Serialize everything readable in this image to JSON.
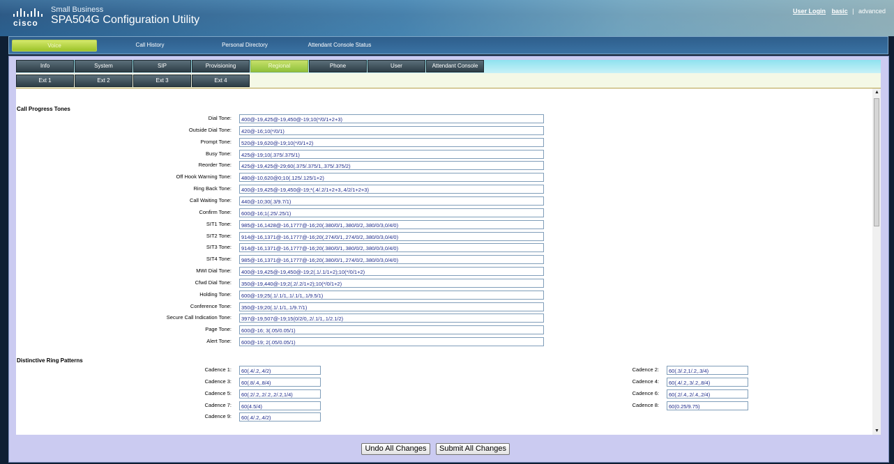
{
  "header": {
    "brand_small": "Small Business",
    "brand_title": "SPA504G Configuration Utility",
    "logo_word": "cisco",
    "links": {
      "user_login": "User Login",
      "basic": "basic",
      "separator": "|",
      "advanced": "advanced"
    }
  },
  "main_nav": [
    {
      "label": "Voice",
      "active": true
    },
    {
      "label": "Call History"
    },
    {
      "label": "Personal Directory"
    },
    {
      "label": "Attendant Console Status"
    }
  ],
  "tabs": [
    {
      "label": "Info"
    },
    {
      "label": "System"
    },
    {
      "label": "SIP"
    },
    {
      "label": "Provisioning"
    },
    {
      "label": "Regional",
      "active": true
    },
    {
      "label": "Phone"
    },
    {
      "label": "User"
    },
    {
      "label": "Attendant Console"
    }
  ],
  "ext_tabs": [
    {
      "label": "Ext 1"
    },
    {
      "label": "Ext 2"
    },
    {
      "label": "Ext 3"
    },
    {
      "label": "Ext 4"
    }
  ],
  "call_progress": {
    "title": "Call Progress Tones",
    "rows": [
      {
        "label": "Dial Tone:",
        "value": "400@-19,425@-19,450@-19;10(*/0/1+2+3)"
      },
      {
        "label": "Outside Dial Tone:",
        "value": "420@-16;10(*/0/1)"
      },
      {
        "label": "Prompt Tone:",
        "value": "520@-19,620@-19;10(*/0/1+2)"
      },
      {
        "label": "Busy Tone:",
        "value": "425@-19;10(.375/.375/1)"
      },
      {
        "label": "Reorder Tone:",
        "value": "425@-19,425@-29;60(.375/.375/1,.375/.375/2)"
      },
      {
        "label": "Off Hook Warning Tone:",
        "value": "480@-10,620@0;10(.125/.125/1+2)"
      },
      {
        "label": "Ring Back Tone:",
        "value": "400@-19,425@-19,450@-19;*(.4/.2/1+2+3,.4/2/1+2+3)"
      },
      {
        "label": "Call Waiting Tone:",
        "value": "440@-10;30(.3/9.7/1)"
      },
      {
        "label": "Confirm Tone:",
        "value": "600@-16;1(.25/.25/1)"
      },
      {
        "label": "SIT1 Tone:",
        "value": "985@-16,1428@-16,1777@-16;20(.380/0/1,.380/0/2,.380/0/3,0/4/0)"
      },
      {
        "label": "SIT2 Tone:",
        "value": "914@-16,1371@-16,1777@-16;20(.274/0/1,.274/0/2,.380/0/3,0/4/0)"
      },
      {
        "label": "SIT3 Tone:",
        "value": "914@-16,1371@-16,1777@-16;20(.380/0/1,.380/0/2,.380/0/3,0/4/0)"
      },
      {
        "label": "SIT4 Tone:",
        "value": "985@-16,1371@-16,1777@-16;20(.380/0/1,.274/0/2,.380/0/3,0/4/0)"
      },
      {
        "label": "MWI Dial Tone:",
        "value": "400@-19,425@-19,450@-19;2(.1/.1/1+2);10(*/0/1+2)"
      },
      {
        "label": "Cfwd Dial Tone:",
        "value": "350@-19,440@-19;2(.2/.2/1+2);10(*/0/1+2)"
      },
      {
        "label": "Holding Tone:",
        "value": "600@-19;25(.1/.1/1,.1/.1/1,.1/9.5/1)"
      },
      {
        "label": "Conference Tone:",
        "value": "350@-19;20(.1/.1/1,.1/9.7/1)"
      },
      {
        "label": "Secure Call Indication Tone:",
        "value": "397@-19,507@-19;15(0/2/0,.2/.1/1,.1/2.1/2)"
      },
      {
        "label": "Page Tone:",
        "value": "600@-16; 3(.05/0.05/1)"
      },
      {
        "label": "Alert Tone:",
        "value": "600@-19; 2(.05/0.05/1)"
      }
    ]
  },
  "ring_patterns": {
    "title": "Distinctive Ring Patterns",
    "left": [
      {
        "label": "Cadence 1:",
        "value": "60(.4/.2,.4/2)"
      },
      {
        "label": "Cadence 3:",
        "value": "60(.8/.4,.8/4)"
      },
      {
        "label": "Cadence 5:",
        "value": "60(.2/.2,.2/.2,.2/.2,1/4)"
      },
      {
        "label": "Cadence 7:",
        "value": "60(4.5/4)"
      },
      {
        "label": "Cadence 9:",
        "value": "60(.4/.2,.4/2)"
      }
    ],
    "right": [
      {
        "label": "Cadence 2:",
        "value": "60(.3/.2,1/.2,.3/4)"
      },
      {
        "label": "Cadence 4:",
        "value": "60(.4/.2,.3/.2,.8/4)"
      },
      {
        "label": "Cadence 6:",
        "value": "60(.2/.4,.2/.4,.2/4)"
      },
      {
        "label": "Cadence 8:",
        "value": "60(0.25/9.75)"
      }
    ]
  },
  "buttons": {
    "undo": "Undo All Changes",
    "submit": "Submit All Changes"
  }
}
